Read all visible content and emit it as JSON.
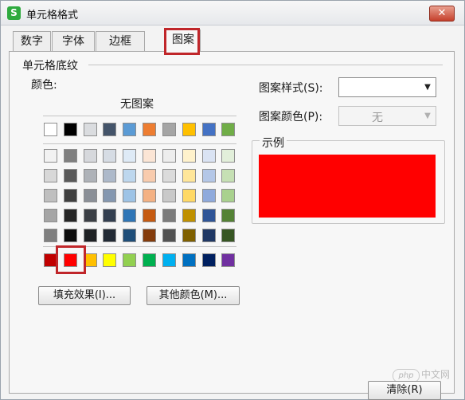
{
  "window": {
    "app_icon": "S",
    "title": "单元格格式",
    "close_symbol": "✕"
  },
  "tabs": [
    {
      "label": "数字"
    },
    {
      "label": "字体"
    },
    {
      "label": "边框"
    },
    {
      "label": "图案",
      "active": true
    }
  ],
  "shading": {
    "group_label": "单元格底纹",
    "color_label": "颜色:",
    "no_pattern_label": "无图案",
    "selected_color": "#ff0000",
    "palette": {
      "standard_row": [
        "#ffffff",
        "#000000",
        "#dadcdf",
        "#44546a",
        "#5b9bd5",
        "#ed7d31",
        "#a5a5a5",
        "#ffc000",
        "#4472c4",
        "#70ad47"
      ],
      "theme_rows": [
        [
          "#f2f2f2",
          "#7f7f7f",
          "#d6d8dc",
          "#d6dce4",
          "#deeaf6",
          "#fbe5d5",
          "#ededed",
          "#fff2cc",
          "#dae3f3",
          "#e2efda"
        ],
        [
          "#d8d8d8",
          "#595959",
          "#aeb2b8",
          "#adb9ca",
          "#bdd7ee",
          "#f8cbad",
          "#dbdbdb",
          "#ffe699",
          "#b4c7e7",
          "#c6e0b4"
        ],
        [
          "#bfbfbf",
          "#3f3f3f",
          "#8a8f97",
          "#8497b0",
          "#9dc3e6",
          "#f4b183",
          "#c9c9c9",
          "#ffd966",
          "#8faadc",
          "#a9d18e"
        ],
        [
          "#a5a5a5",
          "#262626",
          "#3b3f45",
          "#333f50",
          "#2e75b6",
          "#c55a11",
          "#7b7b7b",
          "#bf9000",
          "#2f5597",
          "#548235"
        ],
        [
          "#7f7f7f",
          "#0d0d0d",
          "#1e2124",
          "#222a35",
          "#1f4e79",
          "#843c0c",
          "#525252",
          "#7f6000",
          "#203864",
          "#375623"
        ]
      ],
      "standard_colors": [
        "#c00000",
        "#ff0000",
        "#ffc000",
        "#ffff00",
        "#92d050",
        "#00b050",
        "#00b0f0",
        "#0070c0",
        "#002060",
        "#7030a0"
      ]
    },
    "fill_effects_button": "填充效果(I)...",
    "more_colors_button": "其他颜色(M)..."
  },
  "pattern": {
    "style_label": "图案样式(S):",
    "style_value": "",
    "color_label": "图案颜色(P):",
    "color_value": "无"
  },
  "sample": {
    "label": "示例"
  },
  "footer": {
    "clear_button": "清除(R)"
  },
  "watermark": {
    "logo": "php",
    "text": "中文网"
  }
}
